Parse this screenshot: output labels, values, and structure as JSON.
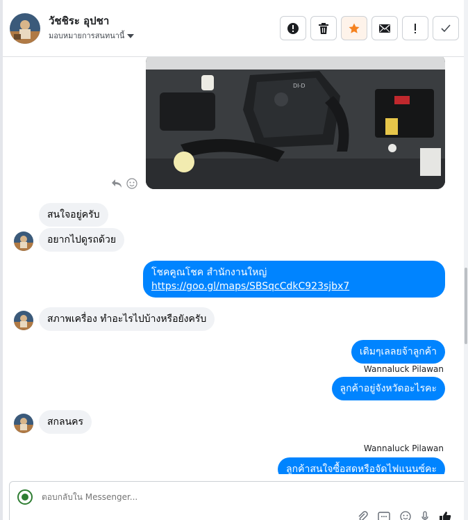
{
  "header": {
    "name": "วัชชิระ อุปชา",
    "assignee": "มอบหมายการสนทนานี้",
    "actions": [
      "mark-spam",
      "delete",
      "star",
      "mark-unread",
      "follow-up",
      "done"
    ]
  },
  "photo_tools": [
    "reply-icon",
    "emoji-reaction-icon"
  ],
  "messages": [
    {
      "dir": "in",
      "text": "สนใจอยู่ครับ"
    },
    {
      "dir": "in",
      "text": "อยากไปดูรถด้วย"
    },
    {
      "dir": "out",
      "line1": "โชคคูณโชค สำนักงานใหญ่",
      "link": "https://goo.gl/maps/SBSqcCdkC923sjbx7"
    },
    {
      "dir": "in",
      "text": "สภาพเครื่อง ทำอะไรไปบ้างหรือยังครับ"
    },
    {
      "dir": "out",
      "text": "เดิมๆเลลยจ้าลูกค้า"
    },
    {
      "dir": "out",
      "sender": "Wannaluck Pilawan",
      "text": "ลูกค้าอยู่จังหวัดอะไรคะ"
    },
    {
      "dir": "in",
      "text": "สกลนคร"
    },
    {
      "dir": "out",
      "sender": "Wannaluck Pilawan",
      "text": "ลูกค้าสนใจซื้อสดหรือจัดไฟแนนซ์คะ"
    }
  ],
  "composer": {
    "placeholder": "ตอบกลับใน Messenger...",
    "tools": [
      "attach-icon",
      "saved-replies-icon",
      "emoji-icon",
      "audio-icon",
      "like-icon"
    ]
  },
  "colors": {
    "outgoing": "#0084ff",
    "incoming": "#f0f2f5",
    "star": "#f5821f"
  }
}
